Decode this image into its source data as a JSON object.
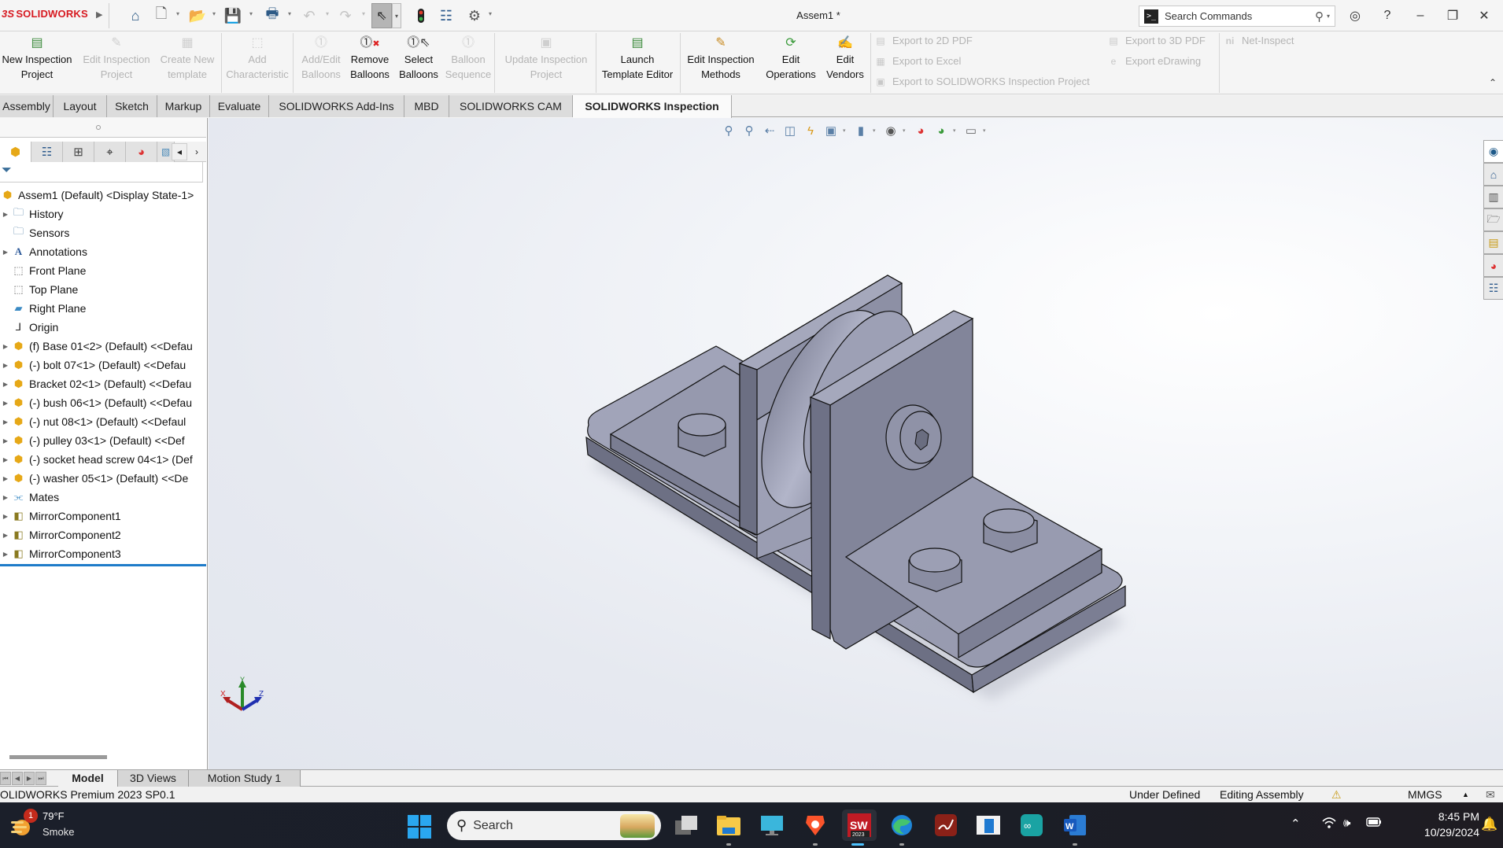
{
  "app": {
    "brand": "SOLIDWORKS",
    "document_title": "Assem1 *"
  },
  "quick_access": [
    {
      "name": "home",
      "icon": "home-icon"
    },
    {
      "name": "new",
      "icon": "new-document-icon"
    },
    {
      "name": "open",
      "icon": "open-folder-icon"
    },
    {
      "name": "save",
      "icon": "save-icon"
    },
    {
      "name": "print",
      "icon": "print-icon"
    },
    {
      "name": "undo",
      "icon": "undo-icon",
      "disabled": true
    },
    {
      "name": "redo",
      "icon": "redo-icon",
      "disabled": true
    },
    {
      "name": "select",
      "icon": "cursor-icon"
    },
    {
      "name": "rebuild",
      "icon": "traffic-light-icon"
    },
    {
      "name": "file-properties",
      "icon": "file-properties-icon"
    },
    {
      "name": "options",
      "icon": "gear-icon"
    }
  ],
  "search_commands": {
    "placeholder": "Search Commands"
  },
  "ribbon": {
    "buttons": [
      {
        "id": "new-inspection-project",
        "line1": "New Inspection",
        "line2": "Project",
        "enabled": true
      },
      {
        "id": "edit-inspection-project",
        "line1": "Edit Inspection",
        "line2": "Project",
        "enabled": false
      },
      {
        "id": "create-new-template",
        "line1": "Create New",
        "line2": "template",
        "enabled": false
      },
      {
        "id": "add-characteristic",
        "line1": "Add",
        "line2": "Characteristic",
        "enabled": false
      },
      {
        "id": "add-edit-balloons",
        "line1": "Add/Edit",
        "line2": "Balloons",
        "enabled": false
      },
      {
        "id": "remove-balloons",
        "line1": "Remove",
        "line2": "Balloons",
        "enabled": true
      },
      {
        "id": "select-balloons",
        "line1": "Select",
        "line2": "Balloons",
        "enabled": true
      },
      {
        "id": "balloon-sequence",
        "line1": "Balloon",
        "line2": "Sequence",
        "enabled": false
      },
      {
        "id": "update-inspection-project",
        "line1": "Update Inspection",
        "line2": "Project",
        "enabled": false
      },
      {
        "id": "launch-template-editor",
        "line1": "Launch",
        "line2": "Template Editor",
        "enabled": true
      },
      {
        "id": "edit-inspection-methods",
        "line1": "Edit Inspection",
        "line2": "Methods",
        "enabled": true
      },
      {
        "id": "edit-operations",
        "line1": "Edit",
        "line2": "Operations",
        "enabled": true
      },
      {
        "id": "edit-vendors",
        "line1": "Edit",
        "line2": "Vendors",
        "enabled": true
      }
    ],
    "exports": [
      {
        "id": "export-2d-pdf",
        "label": "Export to 2D PDF",
        "enabled": false
      },
      {
        "id": "export-excel",
        "label": "Export to Excel",
        "enabled": false
      },
      {
        "id": "export-inspection-project",
        "label": "Export to SOLIDWORKS Inspection Project",
        "enabled": false
      },
      {
        "id": "export-3d-pdf",
        "label": "Export to 3D PDF",
        "enabled": false
      },
      {
        "id": "export-edrawing",
        "label": "Export eDrawing",
        "enabled": false
      },
      {
        "id": "net-inspect",
        "label": "Net-Inspect",
        "enabled": false
      }
    ]
  },
  "command_tabs": [
    {
      "label": "Assembly",
      "active": false
    },
    {
      "label": "Layout",
      "active": false
    },
    {
      "label": "Sketch",
      "active": false
    },
    {
      "label": "Markup",
      "active": false
    },
    {
      "label": "Evaluate",
      "active": false
    },
    {
      "label": "SOLIDWORKS Add-Ins",
      "active": false
    },
    {
      "label": "MBD",
      "active": false
    },
    {
      "label": "SOLIDWORKS CAM",
      "active": false
    },
    {
      "label": "SOLIDWORKS Inspection",
      "active": true
    }
  ],
  "feature_tree": {
    "panel_tabs": [
      "FeatureManager",
      "PropertyManager",
      "ConfigurationManager",
      "DimXpertManager",
      "DisplayManager",
      "CAM"
    ],
    "items": [
      {
        "label": "Assem1 (Default) <Display State-1>",
        "icon": "assembly-icon",
        "expandable": false,
        "root": true
      },
      {
        "label": "History",
        "icon": "history-folder-icon",
        "expandable": true
      },
      {
        "label": "Sensors",
        "icon": "sensors-folder-icon",
        "expandable": false
      },
      {
        "label": "Annotations",
        "icon": "annotations-folder-icon",
        "expandable": true
      },
      {
        "label": "Front Plane",
        "icon": "plane-icon",
        "expandable": false
      },
      {
        "label": "Top Plane",
        "icon": "plane-icon",
        "expandable": false
      },
      {
        "label": "Right Plane",
        "icon": "plane-selected-icon",
        "expandable": false
      },
      {
        "label": "Origin",
        "icon": "origin-icon",
        "expandable": false
      },
      {
        "label": "(f) Base 01<2> (Default) <<Defau",
        "icon": "part-icon",
        "expandable": true
      },
      {
        "label": "(-) bolt 07<1> (Default) <<Defau",
        "icon": "part-icon",
        "expandable": true
      },
      {
        "label": "Bracket 02<1> (Default) <<Defau",
        "icon": "part-icon",
        "expandable": true
      },
      {
        "label": "(-) bush 06<1> (Default) <<Defau",
        "icon": "part-icon",
        "expandable": true
      },
      {
        "label": "(-) nut 08<1> (Default) <<Defaul",
        "icon": "part-icon",
        "expandable": true
      },
      {
        "label": "(-) pulley 03<1> (Default) <<Def",
        "icon": "part-icon",
        "expandable": true
      },
      {
        "label": "(-) socket head screw 04<1> (Def",
        "icon": "part-icon",
        "expandable": true
      },
      {
        "label": "(-) washer 05<1> (Default) <<De",
        "icon": "part-icon",
        "expandable": true
      },
      {
        "label": "Mates",
        "icon": "mates-icon",
        "expandable": true
      },
      {
        "label": "MirrorComponent1",
        "icon": "mirror-component-icon",
        "expandable": true
      },
      {
        "label": "MirrorComponent2",
        "icon": "mirror-component-icon",
        "expandable": true
      },
      {
        "label": "MirrorComponent3",
        "icon": "mirror-component-icon",
        "expandable": true
      }
    ]
  },
  "viewport": {
    "triad": {
      "x": "X",
      "y": "Y",
      "z": "Z"
    },
    "heads_up_toolbar": [
      "zoom-to-fit",
      "zoom-to-area",
      "previous-view",
      "section-view",
      "dynamic-annotation-views",
      "view-orientation",
      "display-style",
      "hide-show-items",
      "edit-appearance",
      "apply-scene",
      "view-settings"
    ],
    "task_pane": [
      "3dexperience",
      "solidworks-resources",
      "design-library",
      "file-explorer",
      "view-palette",
      "appearances",
      "custom-properties"
    ]
  },
  "bottom_tabs": [
    {
      "label": "Model",
      "active": true
    },
    {
      "label": "3D Views",
      "active": false
    },
    {
      "label": "Motion Study 1",
      "active": false
    }
  ],
  "status_bar": {
    "version": "OLIDWORKS Premium 2023 SP0.1",
    "definition": "Under Defined",
    "mode": "Editing Assembly",
    "units": "MMGS"
  },
  "taskbar": {
    "weather": {
      "temp": "79°F",
      "condition": "Smoke",
      "badge": "1"
    },
    "search_placeholder": "Search",
    "apps": [
      "task-view",
      "file-explorer",
      "remote-desktop",
      "brave",
      "solidworks-2023",
      "edge",
      "app-red",
      "app-window",
      "arduino",
      "word"
    ],
    "active_app": "solidworks-2023",
    "time": "8:45 PM",
    "date": "10/29/2024"
  }
}
